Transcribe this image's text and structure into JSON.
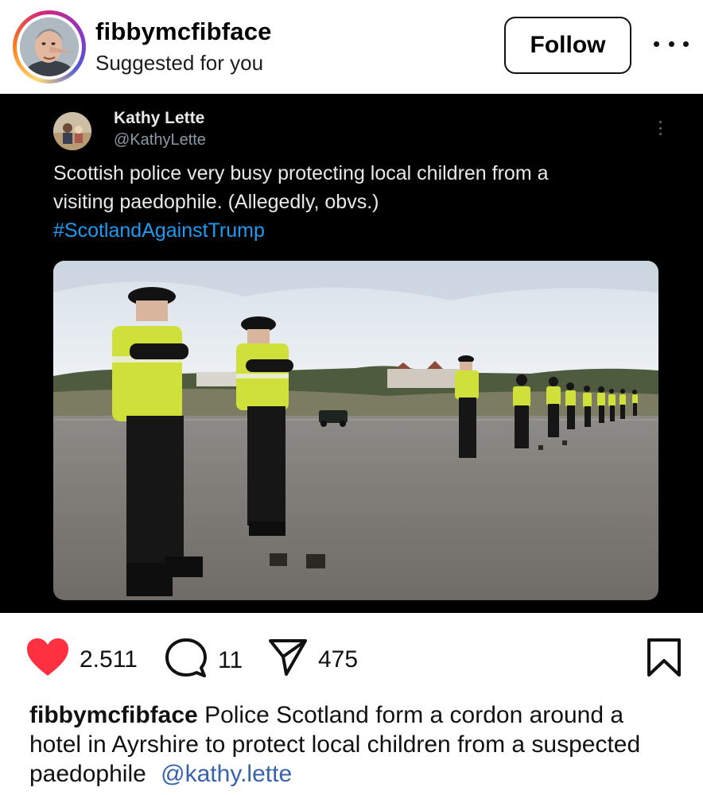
{
  "post": {
    "username": "fibbymcfibface",
    "subtitle": "Suggested for you",
    "follow_label": "Follow"
  },
  "tweet": {
    "name": "Kathy Lette",
    "handle": "@KathyLette",
    "text": "Scottish police very busy protecting local children from a visiting paedophile. (Allegedly, obvs.)",
    "hashtag": "#ScotlandAgainstTrump"
  },
  "actions": {
    "likes": "2.511",
    "comments": "11",
    "shares": "475"
  },
  "caption": {
    "username": "fibbymcfibface",
    "text": "Police Scotland form a cordon around a hotel in Ayrshire to protect local children from a suspected paedophile",
    "mention": "@kathy.lette"
  },
  "colors": {
    "like_red": "#ff3040",
    "hashtag_blue": "#1d9bf0",
    "mention_blue": "#3763a8",
    "hi_vis_yellow": "#d4e82a"
  },
  "icons": [
    "heart-icon",
    "comment-icon",
    "share-icon",
    "bookmark-icon",
    "more-icon"
  ]
}
